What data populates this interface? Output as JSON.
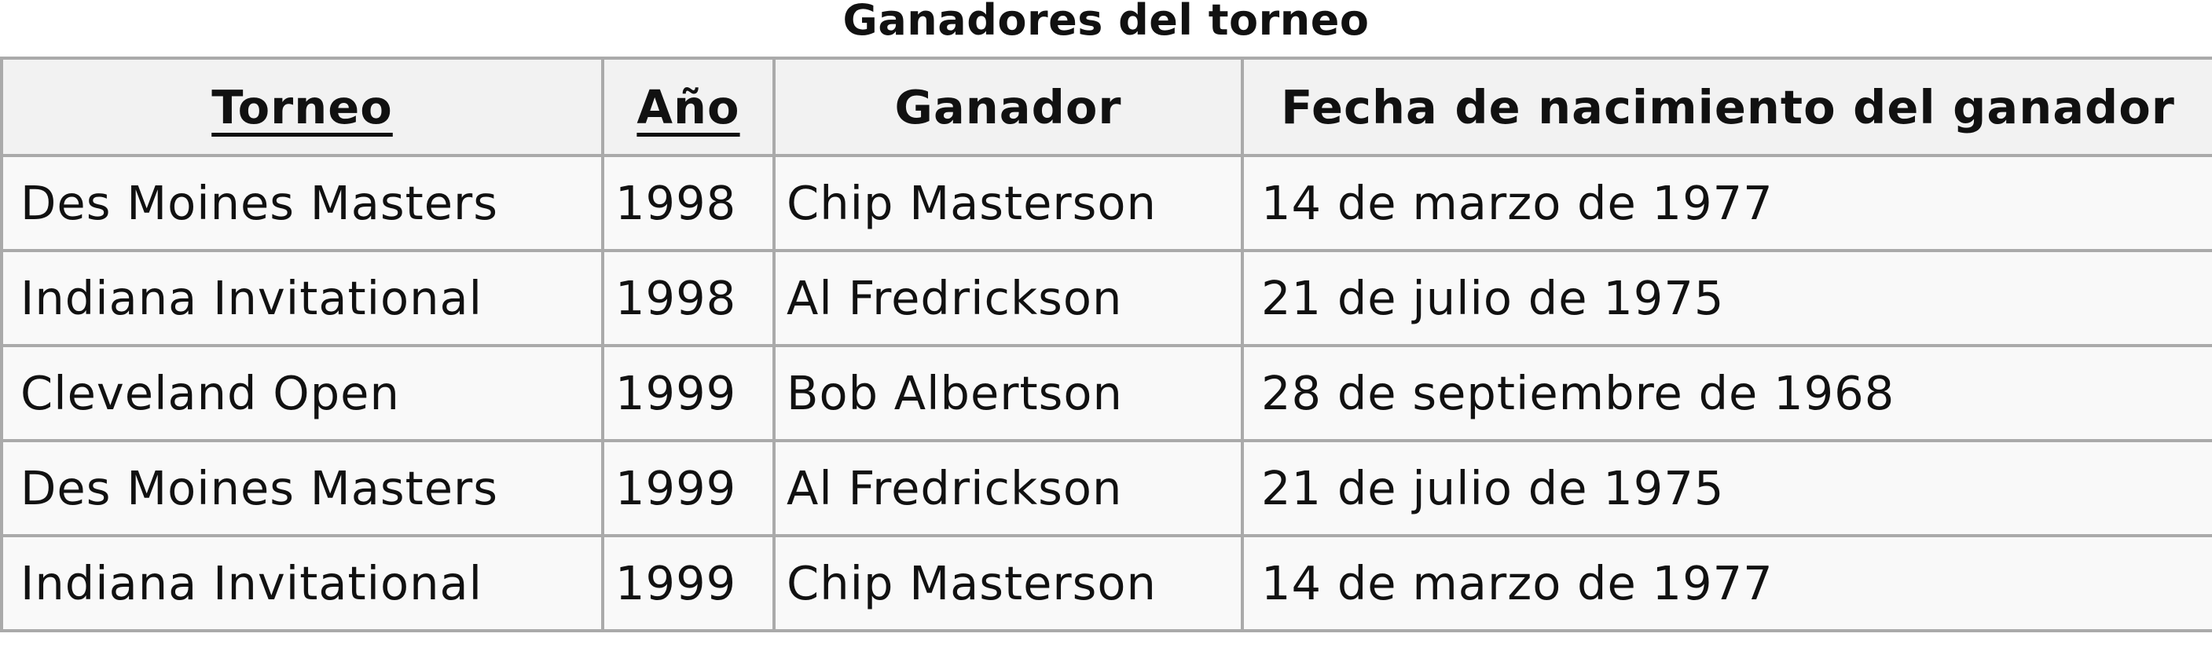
{
  "caption": "Ganadores del torneo",
  "headers": {
    "torneo": "Torneo",
    "anio": "Año",
    "ganador": "Ganador",
    "fecha": "Fecha de nacimiento del ganador"
  },
  "rows": [
    {
      "torneo": "Des Moines Masters",
      "anio": "1998",
      "ganador": "Chip Masterson",
      "fecha": "14 de marzo de 1977"
    },
    {
      "torneo": "Indiana Invitational",
      "anio": "1998",
      "ganador": "Al Fredrickson",
      "fecha": "21 de julio de 1975"
    },
    {
      "torneo": "Cleveland Open",
      "anio": "1999",
      "ganador": "Bob Albertson",
      "fecha": "28 de septiembre de 1968"
    },
    {
      "torneo": "Des Moines Masters",
      "anio": "1999",
      "ganador": "Al Fredrickson",
      "fecha": "21 de julio de 1975"
    },
    {
      "torneo": "Indiana Invitational",
      "anio": "1999",
      "ganador": "Chip Masterson",
      "fecha": "14 de marzo de 1977"
    }
  ]
}
